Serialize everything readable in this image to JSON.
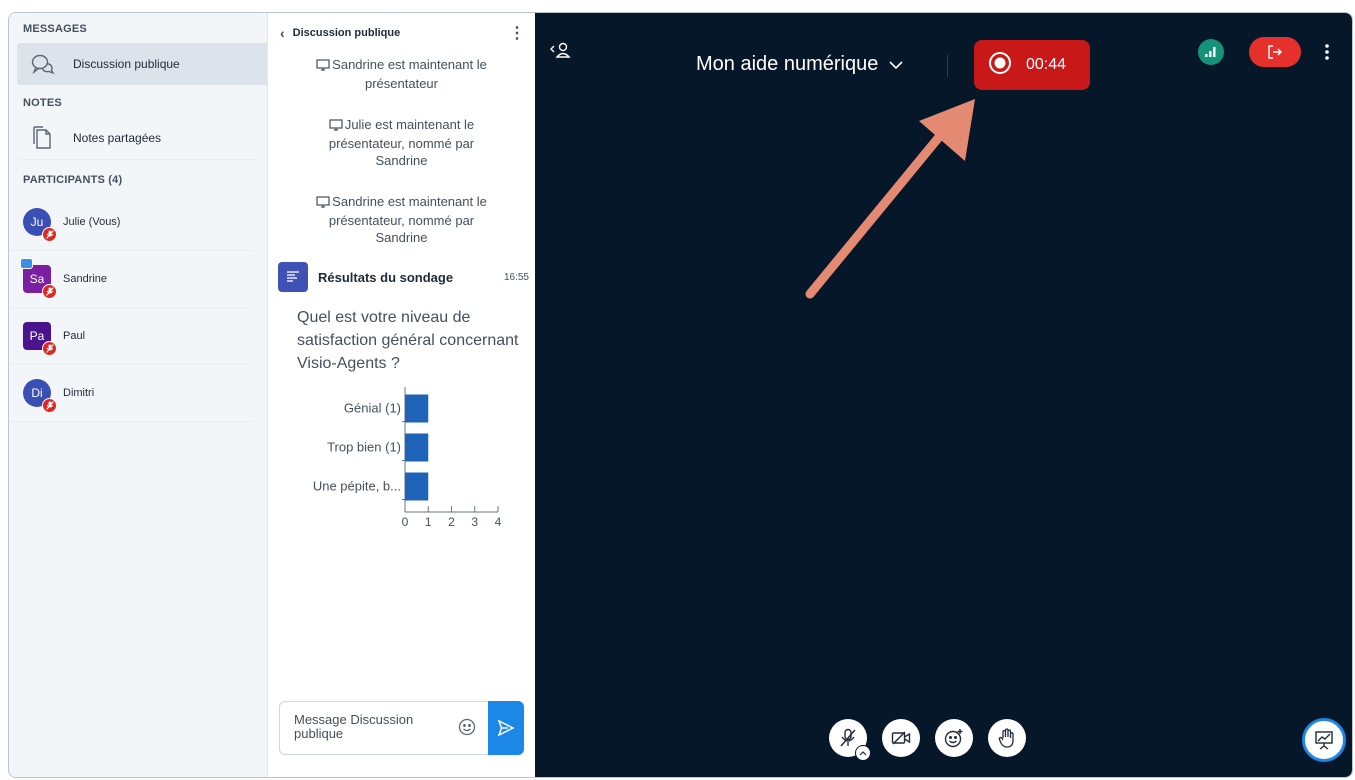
{
  "sidebar": {
    "messages_title": "MESSAGES",
    "public_chat_label": "Discussion publique",
    "notes_title": "NOTES",
    "shared_notes_label": "Notes partagées",
    "participants_title": "PARTICIPANTS (4)",
    "participants": [
      {
        "initials": "Ju",
        "name": "Julie (Vous)",
        "color": "#3a4fb3",
        "shape": "round",
        "presenter": false
      },
      {
        "initials": "Sa",
        "name": "Sandrine",
        "color": "#7b1fa2",
        "shape": "square",
        "presenter": true
      },
      {
        "initials": "Pa",
        "name": "Paul",
        "color": "#4a148c",
        "shape": "square",
        "presenter": false
      },
      {
        "initials": "Di",
        "name": "Dimitri",
        "color": "#3a4fb3",
        "shape": "round",
        "presenter": false
      }
    ]
  },
  "chat": {
    "header": "Discussion publique",
    "system_messages": [
      "Sandrine est maintenant le présentateur",
      "Julie est maintenant le présentateur, nommé par Sandrine",
      "Sandrine est maintenant le présentateur, nommé par Sandrine"
    ],
    "poll": {
      "title": "Résultats du sondage",
      "time": "16:55",
      "question": "Quel est votre niveau de satisfaction général concernant Visio-Agents ?"
    },
    "input_placeholder": "Message Discussion publique"
  },
  "chart_data": {
    "type": "bar",
    "orientation": "horizontal",
    "categories": [
      "Génial (1)",
      "Trop bien (1)",
      "Une pépite, b..."
    ],
    "values": [
      1,
      1,
      1
    ],
    "xlim": [
      0,
      4
    ],
    "xticks": [
      "0",
      "1",
      "2",
      "3",
      "4"
    ],
    "bar_color": "#1e63b8"
  },
  "main": {
    "meeting_title": "Mon aide numérique",
    "recording_time": "00:44",
    "accent_record": "#c91818",
    "accent_leave": "#e5302b",
    "connection_color": "#14937a"
  },
  "icons": {
    "users_toggle": "users-toggle-icon",
    "mic": "mic-muted-icon",
    "camera": "camera-off-icon",
    "reactions": "emoji-plus-icon",
    "raise_hand": "hand-icon",
    "presentation": "presentation-icon"
  }
}
